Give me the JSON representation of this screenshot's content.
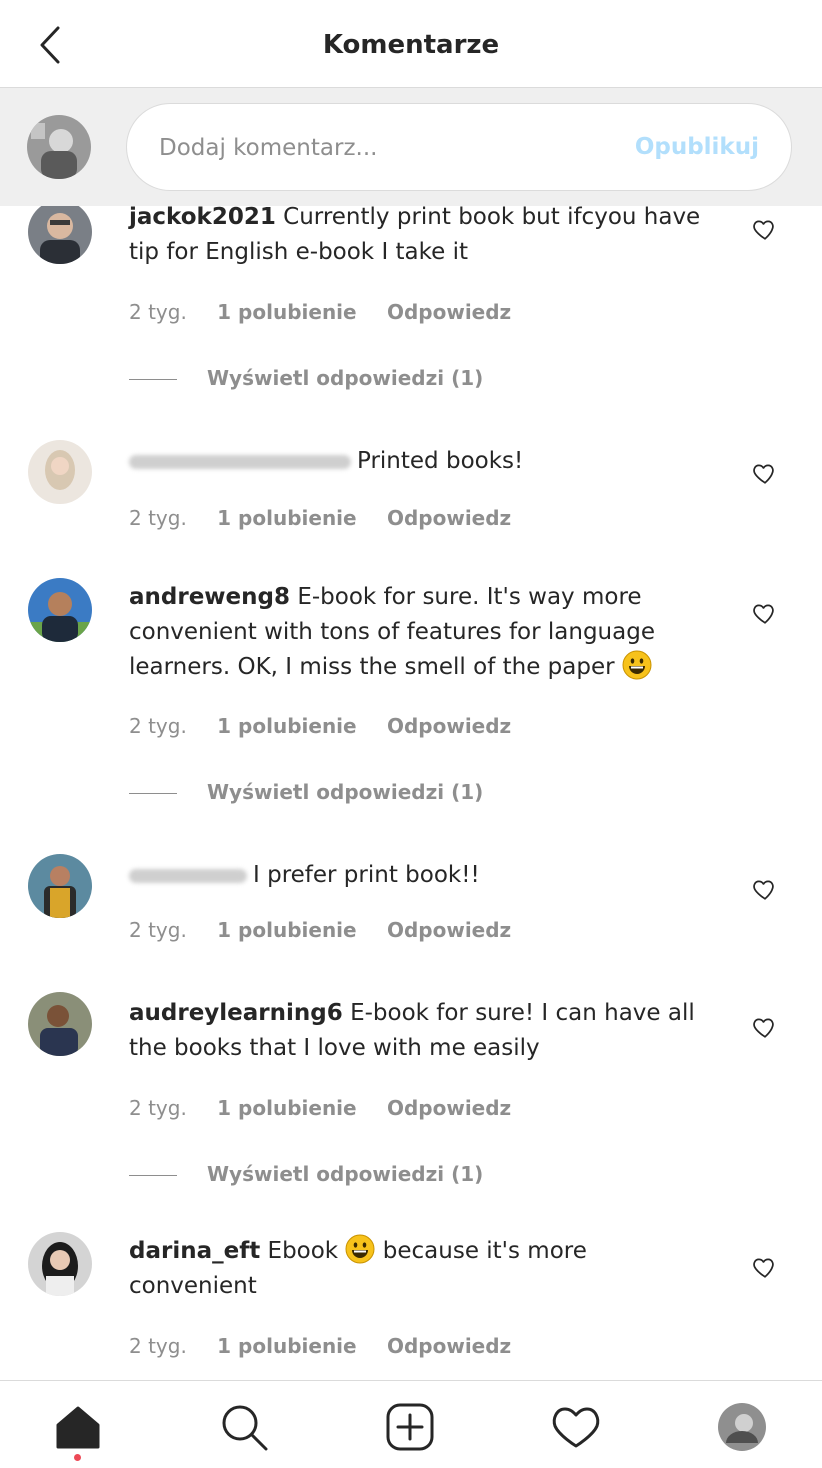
{
  "header": {
    "title": "Komentarze",
    "back_icon": "chevron-left-icon"
  },
  "composer": {
    "placeholder": "Dodaj komentarz...",
    "publish_label": "Opublikuj"
  },
  "comments": [
    {
      "username": "jackok2021",
      "text": "Currently print book but ifcyou have tip for English e-book I take it",
      "time": "2 tyg.",
      "likes": "1 polubienie",
      "reply": "Odpowiedz",
      "view_replies": "Wyświetl odpowiedzi (1)"
    },
    {
      "username": "",
      "username_blurred": true,
      "text": "Printed books!",
      "time": "2 tyg.",
      "likes": "1 polubienie",
      "reply": "Odpowiedz"
    },
    {
      "username": "andreweng8",
      "text": "E-book for sure. It's way more convenient with tons of features for language learners. OK, I miss the smell of the paper",
      "time": "2 tyg.",
      "likes": "1 polubienie",
      "reply": "Odpowiedz",
      "view_replies": "Wyświetl odpowiedzi (1)"
    },
    {
      "username": "",
      "username_blurred": true,
      "text": "I prefer print book!!",
      "time": "2 tyg.",
      "likes": "1 polubienie",
      "reply": "Odpowiedz"
    },
    {
      "username": "audreylearning6",
      "text": "E-book for sure! I can have all the books that I love with me easily",
      "time": "2 tyg.",
      "likes": "1 polubienie",
      "reply": "Odpowiedz",
      "view_replies": "Wyświetl odpowiedzi (1)"
    },
    {
      "username": "darina_eft",
      "text_before": "Ebook",
      "text_after": "because it's more convenient",
      "time": "2 tyg.",
      "likes": "1 polubienie",
      "reply": "Odpowiedz"
    }
  ],
  "tabbar": {
    "icons": [
      "home-icon",
      "search-icon",
      "new-post-icon",
      "activity-heart-icon",
      "profile-avatar"
    ]
  },
  "colors": {
    "link_blue_disabled": "#b2dffc",
    "secondary_text": "#8e8e8e",
    "notification_dot": "#ed4956",
    "composer_bg": "#efefef"
  }
}
